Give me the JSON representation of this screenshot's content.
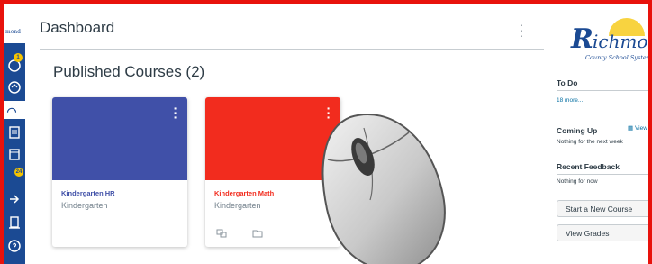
{
  "colors": {
    "frame": "#e8120c",
    "nav": "#1b4a93",
    "badge": "#f5c400",
    "link": "#0770a3"
  },
  "nav": {
    "logo_text": "mond",
    "items": [
      {
        "icon": "account-icon",
        "badge": "1"
      },
      {
        "icon": "admin-icon"
      },
      {
        "icon": "dashboard-icon"
      },
      {
        "icon": "courses-icon"
      },
      {
        "icon": "calendar-icon",
        "badge": "24"
      },
      {
        "icon": "inbox-icon"
      },
      {
        "icon": "commons-icon"
      },
      {
        "icon": "help-icon"
      }
    ]
  },
  "header": {
    "title": "Dashboard"
  },
  "main": {
    "section_title": "Published Courses (2)",
    "courses": [
      {
        "name": "Kindergarten HR",
        "term": "Kindergarten",
        "color": "#4050a8",
        "name_color": "#4050a8"
      },
      {
        "name": "Kindergarten Math",
        "term": "Kindergarten",
        "color": "#f22c1e",
        "name_color": "#f22c1e"
      }
    ]
  },
  "sidebar": {
    "logo": {
      "letter": "R",
      "rest": "ichmond",
      "subtitle": "County School System"
    },
    "todo": {
      "heading": "To Do",
      "more": "18 more..."
    },
    "coming_up": {
      "heading": "Coming Up",
      "view": "View",
      "empty": "Nothing for the next week"
    },
    "recent_feedback": {
      "heading": "Recent Feedback",
      "empty": "Nothing for now"
    },
    "buttons": {
      "start_course": "Start a New Course",
      "view_grades": "View Grades"
    }
  }
}
